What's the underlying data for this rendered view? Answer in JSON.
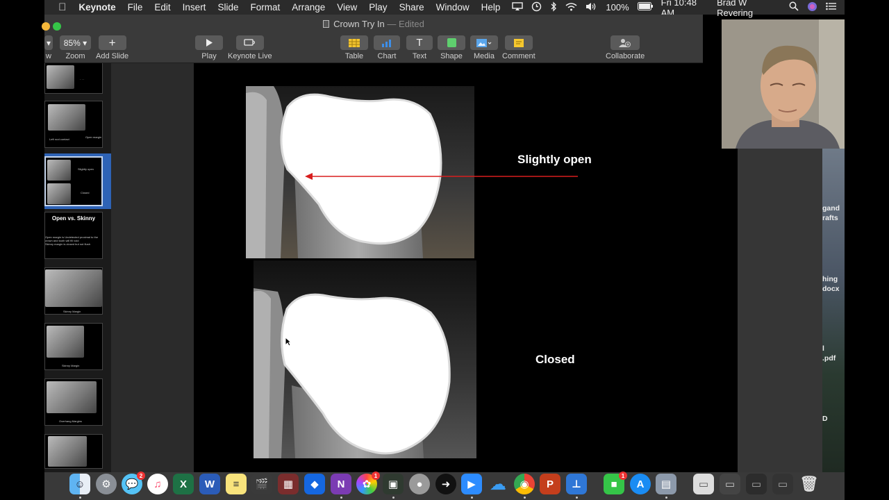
{
  "menubar": {
    "app_name": "Keynote",
    "items": [
      "File",
      "Edit",
      "Insert",
      "Slide",
      "Format",
      "Arrange",
      "View",
      "Play",
      "Share",
      "Window",
      "Help"
    ],
    "battery": "100%",
    "clock": "Fri 10:48 AM",
    "user": "Brad W Revering"
  },
  "window": {
    "title": "Crown Try In",
    "status": "— Edited"
  },
  "toolbar": {
    "view_label": "w",
    "zoom_value": "85%",
    "zoom_label": "Zoom",
    "add_slide_label": "Add Slide",
    "play_label": "Play",
    "keynote_live_label": "Keynote Live",
    "table_label": "Table",
    "chart_label": "Chart",
    "text_label": "Text",
    "shape_label": "Shape",
    "media_label": "Media",
    "comment_label": "Comment",
    "collaborate_label": "Collaborate"
  },
  "navigator": {
    "thumb2_caption_left": "Left root contact",
    "thumb2_caption_right": "Open margin",
    "thumb3_caption_top": "Slightly open",
    "thumb3_caption_bottom": "Closed",
    "thumb4_title": "Open vs. Skinny",
    "thumb4_line1": "Open margin is Undetected proximal to the crown and tooth will fill void",
    "thumb4_line2": "Skinny margin is closed but not flush",
    "thumb5_caption": "Skinny Margin",
    "thumb6_caption": "Skinny Margin",
    "thumb7_caption": "Overhang Margins"
  },
  "slide": {
    "label_top": "Slightly open",
    "label_bottom": "Closed",
    "arrow_color": "#d81e1e"
  },
  "desktop": {
    "text1": "gand",
    "text2": "rafts",
    "text3": "hing",
    "text4": "docx",
    "text5": "l",
    ".pdf_label": ".pdf",
    "text6": "D"
  },
  "dock": {
    "badges": {
      "messages": "2",
      "photos": "1",
      "facetime": "1"
    }
  }
}
